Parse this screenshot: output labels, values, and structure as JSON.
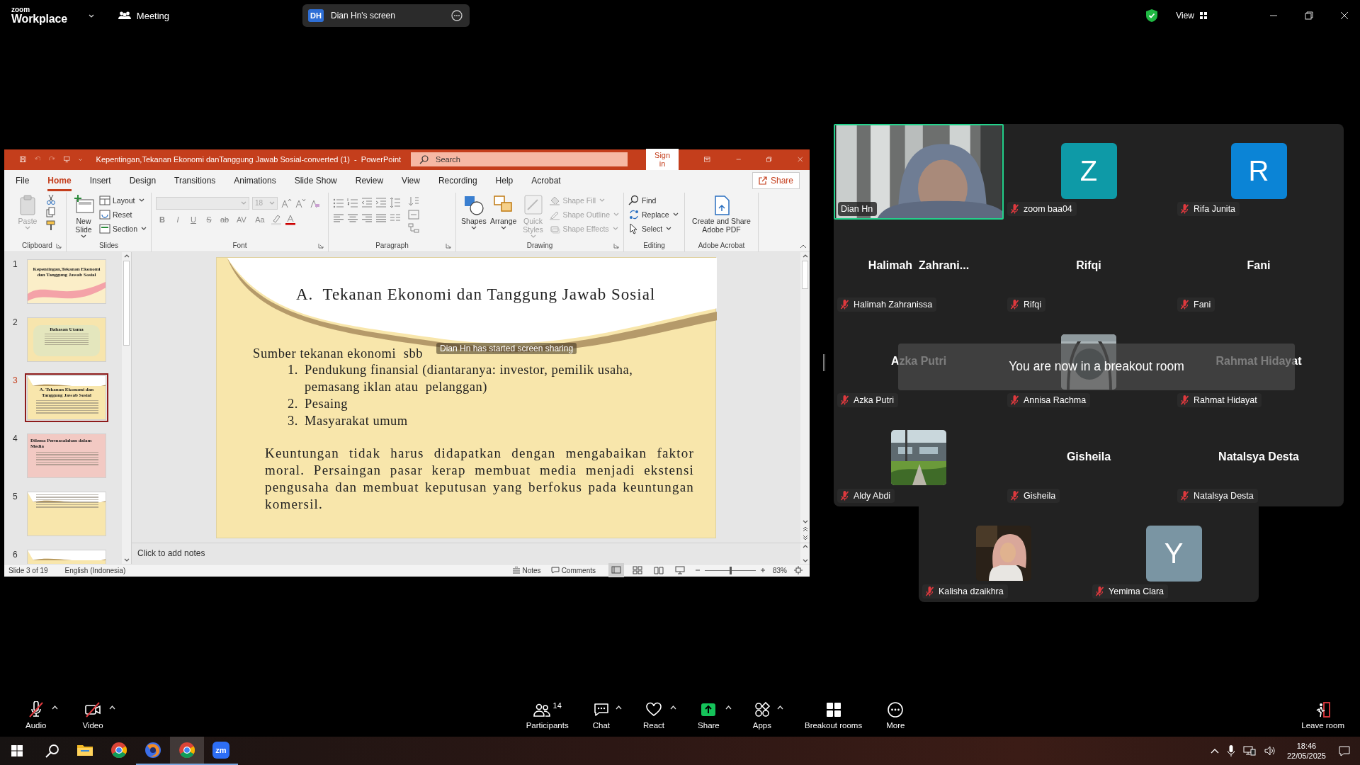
{
  "top_bar": {
    "brand_small": "zoom",
    "brand": "Workplace",
    "meeting": "Meeting",
    "share_tab": {
      "initials": "DH",
      "label": "Dian Hn's screen"
    },
    "view": "View"
  },
  "powerpoint": {
    "title": "Kepentingan,Tekanan Ekonomi danTanggung Jawab Sosial-converted (1)  -  PowerPoint",
    "search": {
      "placeholder": "Search"
    },
    "sign_in": "Sign in",
    "tabs": [
      {
        "label": "File",
        "selected": false
      },
      {
        "label": "Home",
        "selected": true
      },
      {
        "label": "Insert",
        "selected": false
      },
      {
        "label": "Design",
        "selected": false
      },
      {
        "label": "Transitions",
        "selected": false
      },
      {
        "label": "Animations",
        "selected": false
      },
      {
        "label": "Slide Show",
        "selected": false
      },
      {
        "label": "Review",
        "selected": false
      },
      {
        "label": "View",
        "selected": false
      },
      {
        "label": "Recording",
        "selected": false
      },
      {
        "label": "Help",
        "selected": false
      },
      {
        "label": "Acrobat",
        "selected": false
      }
    ],
    "share": "Share",
    "ribbon": [
      {
        "label": "Clipboard",
        "kind": "clipboard",
        "items": [
          {
            "label": "Paste",
            "kind": "large",
            "disabled": true,
            "dropdown": true
          }
        ]
      },
      {
        "label": "Slides",
        "kind": "slides",
        "items": [
          {
            "label": "New Slide",
            "kind": "large",
            "disabled": false,
            "dropdown": true
          },
          {
            "label": "Layout",
            "kind": "small",
            "disabled": false,
            "dropdown": true
          },
          {
            "label": "Reset",
            "kind": "small",
            "disabled": false,
            "dropdown": false
          },
          {
            "label": "Section",
            "kind": "small",
            "disabled": false,
            "dropdown": true
          }
        ]
      },
      {
        "label": "Font",
        "kind": "font",
        "font_size": "18",
        "buttons": [
          "B",
          "I",
          "U",
          "S",
          "ab",
          "AV",
          "Aa"
        ]
      },
      {
        "label": "Paragraph",
        "kind": "paragraph"
      },
      {
        "label": "Drawing",
        "kind": "drawing",
        "items": [
          {
            "label": "Shapes",
            "kind": "large",
            "disabled": false,
            "dropdown": true
          },
          {
            "label": "Arrange",
            "kind": "large",
            "disabled": false,
            "dropdown": true
          },
          {
            "label": "Quick Styles",
            "kind": "large",
            "disabled": true,
            "dropdown": true
          },
          {
            "label": "Shape Fill",
            "kind": "small",
            "disabled": true,
            "dropdown": true
          },
          {
            "label": "Shape Outline",
            "kind": "small",
            "disabled": true,
            "dropdown": true
          },
          {
            "label": "Shape Effects",
            "kind": "small",
            "disabled": true,
            "dropdown": true
          }
        ]
      },
      {
        "label": "Editing",
        "kind": "editing",
        "items": [
          {
            "label": "Find",
            "kind": "small",
            "disabled": false,
            "dropdown": false
          },
          {
            "label": "Replace",
            "kind": "small",
            "disabled": false,
            "dropdown": true
          },
          {
            "label": "Select",
            "kind": "small",
            "disabled": false,
            "dropdown": true
          }
        ]
      },
      {
        "label": "Adobe Acrobat",
        "kind": "acrobat",
        "items": [
          {
            "label": "Create and Share Adobe PDF",
            "kind": "large",
            "disabled": false,
            "dropdown": false
          }
        ]
      }
    ],
    "thumbnails": [
      {
        "number": "1",
        "selected": false,
        "kind": "title",
        "title": "Kepentingan,Tekanan Ekonomi dan Tanggung Jawab Sosial"
      },
      {
        "number": "2",
        "selected": false,
        "kind": "list",
        "title": "Bahasan Utama"
      },
      {
        "number": "3",
        "selected": true,
        "kind": "content",
        "title": "A. Tekanan Ekonomi dan Tanggung Jawab Sosial"
      },
      {
        "number": "4",
        "selected": false,
        "kind": "pink",
        "title": "Dilema Permasalahan dalam Media"
      },
      {
        "number": "5",
        "selected": false,
        "kind": "content"
      },
      {
        "number": "6",
        "selected": false,
        "kind": "partial"
      }
    ],
    "slide": {
      "title": "A.  Tekanan Ekonomi dan Tanggung Jawab Sosial",
      "intro": "Sumber tekanan ekonomi  sbb",
      "list": [
        {
          "number": "1.",
          "text": "Pendukung finansial (diantaranya: investor, pemilik usaha, pemasang iklan atau  pelanggan)"
        },
        {
          "number": "2.",
          "text": "Pesaing"
        },
        {
          "number": "3.",
          "text": "Masyarakat umum"
        }
      ],
      "paragraph": "Keuntungan tidak harus didapatkan dengan mengabaikan faktor moral. Persaingan pasar kerap membuat media menjadi ekstensi pengusaha dan membuat keputusan yang berfokus pada  keuntungan komersil."
    },
    "notes": {
      "placeholder": "Click to add notes"
    },
    "status": {
      "slide": "Slide 3 of 19",
      "language": "English (Indonesia)",
      "notes": "Notes",
      "comments": "Comments",
      "views": [
        {
          "selected": true
        },
        {
          "selected": false
        },
        {
          "selected": false
        },
        {
          "selected": false
        }
      ],
      "zoom_slider": {
        "level": 0.5
      },
      "zoom": "83%"
    }
  },
  "screen_share_notice": "Dian Hn has started screen sharing",
  "gallery": {
    "tiles": [
      {
        "name": "Dian Hn",
        "kind": "video",
        "active_speaker": true,
        "muted": false
      },
      {
        "name": "zoom baa04",
        "kind": "avatar",
        "initial": "Z",
        "color": "#0e9aa7",
        "active_speaker": false,
        "muted": true
      },
      {
        "name": "Rifa Junita",
        "kind": "avatar",
        "initial": "R",
        "color": "#0b84d6",
        "active_speaker": false,
        "muted": true
      },
      {
        "name": "Halimah Zahranissa",
        "kind": "name",
        "display_name": "Halimah  Zahrani...",
        "active_speaker": false,
        "muted": true
      },
      {
        "name": "Rifqi",
        "kind": "name",
        "display_name": "Rifqi",
        "active_speaker": false,
        "muted": true
      },
      {
        "name": "Fani",
        "kind": "name",
        "display_name": "Fani",
        "active_speaker": false,
        "muted": true
      },
      {
        "name": "Azka Putri",
        "kind": "name",
        "display_name": "Azka Putri",
        "active_speaker": false,
        "muted": true
      },
      {
        "name": "Annisa Rachma",
        "kind": "picture",
        "active_speaker": false,
        "muted": true
      },
      {
        "name": "Rahmat Hidayat",
        "kind": "name",
        "display_name": "Rahmat Hidayat",
        "active_speaker": false,
        "muted": true
      },
      {
        "name": "Aldy Abdi",
        "kind": "picture",
        "active_speaker": false,
        "muted": true
      },
      {
        "name": "Gisheila",
        "kind": "name",
        "display_name": "Gisheila",
        "active_speaker": false,
        "muted": true
      },
      {
        "name": "Natalsya Desta",
        "kind": "name",
        "display_name": "Natalsya Desta",
        "active_speaker": false,
        "muted": true
      },
      {
        "name": "Kalisha dzaikhra",
        "kind": "picture",
        "active_speaker": false,
        "muted": true
      },
      {
        "name": "Yemima Clara",
        "kind": "avatar",
        "initial": "Y",
        "color": "#7a95a3",
        "active_speaker": false,
        "muted": true
      }
    ],
    "toast": "You are now in a breakout room"
  },
  "toolbar": {
    "buttons": [
      {
        "label": "Audio",
        "kind": "audio",
        "off": true,
        "caret": true
      },
      {
        "label": "Video",
        "kind": "video",
        "off": true,
        "caret": true
      },
      {
        "label": "Participants",
        "kind": "participants",
        "count": "14",
        "off": false,
        "caret": false
      },
      {
        "label": "Chat",
        "kind": "chat",
        "off": false,
        "caret": true
      },
      {
        "label": "React",
        "kind": "react",
        "off": false,
        "caret": true
      },
      {
        "label": "Share",
        "kind": "share",
        "off": false,
        "caret": true
      },
      {
        "label": "Apps",
        "kind": "apps",
        "off": false,
        "caret": true
      },
      {
        "label": "Breakout rooms",
        "kind": "breakout",
        "off": false,
        "caret": false
      },
      {
        "label": "More",
        "kind": "more",
        "off": false,
        "caret": false
      }
    ],
    "leave": "Leave room"
  },
  "taskbar": {
    "apps": [
      {
        "kind": "explorer",
        "running": false,
        "active": false
      },
      {
        "kind": "chrome",
        "running": false,
        "active": false
      },
      {
        "kind": "browser",
        "running": true,
        "active": false
      },
      {
        "kind": "chrome",
        "running": true,
        "active": true
      },
      {
        "kind": "zoom",
        "label": "zm",
        "running": true,
        "active": false
      }
    ],
    "time": "18:46",
    "date": "22/05/2025"
  }
}
